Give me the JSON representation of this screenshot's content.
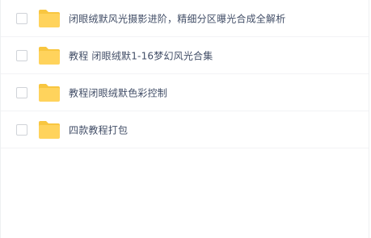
{
  "file_list": {
    "items": [
      {
        "name": "闭眼绒默风光摄影进阶，精细分区曝光合成全解析",
        "icon": "folder-icon"
      },
      {
        "name": "教程 闭眼绒默1-16梦幻风光合集",
        "icon": "folder-icon"
      },
      {
        "name": "教程闭眼绒默色彩控制",
        "icon": "folder-icon"
      },
      {
        "name": "四款教程打包",
        "icon": "folder-icon"
      }
    ]
  },
  "colors": {
    "folder": "#ffd35c",
    "folder_tab": "#f8c640",
    "text": "#424e67",
    "row_border": "#f2f3f5",
    "checkbox_border": "#d0d3d8"
  }
}
